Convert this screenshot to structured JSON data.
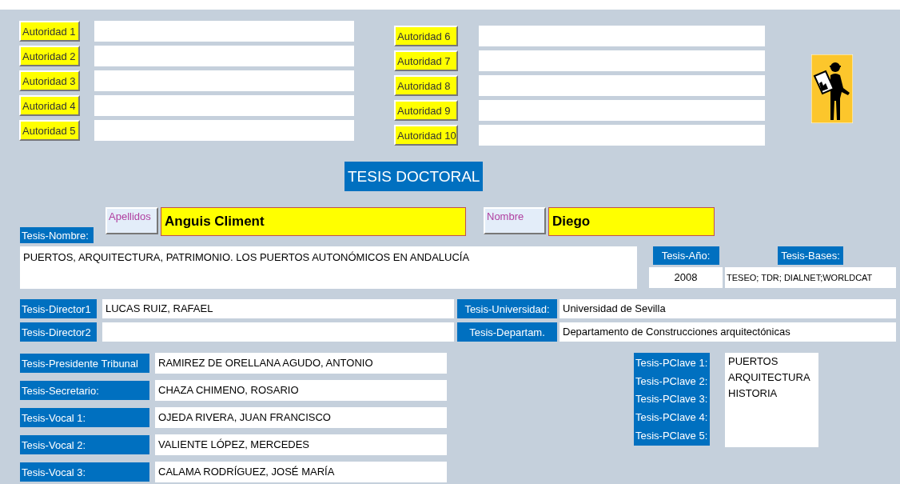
{
  "authority_buttons": [
    "Autoridad 1",
    "Autoridad 2",
    "Autoridad 3",
    "Autoridad 4",
    "Autoridad 5",
    "Autoridad 6",
    "Autoridad 7",
    "Autoridad 8",
    "Autoridad 9",
    "Autoridad 10"
  ],
  "title": "TESIS DOCTORAL",
  "name_label": "Tesis-Nombre:",
  "surname": {
    "button": "Apellidos",
    "value": "Anguis Climent"
  },
  "first_name": {
    "button": "Nombre",
    "value": "Diego"
  },
  "thesis_title": "PUERTOS, ARQUITECTURA, PATRIMONIO. LOS PUERTOS AUTONÓMICOS EN ANDALUCÍA",
  "year": {
    "label": "Tesis-Año:",
    "value": "2008"
  },
  "bases": {
    "label": "Tesis-Bases:",
    "value": "TESEO; TDR; DIALNET;WORLDCAT"
  },
  "directors": [
    {
      "label": "Tesis-Director1",
      "value": "LUCAS RUIZ, RAFAEL"
    },
    {
      "label": "Tesis-Director2"
    }
  ],
  "institutions": [
    {
      "label": "Tesis-Universidad:",
      "value": "Universidad de Sevilla"
    },
    {
      "label": "Tesis-Departam.",
      "value": "Departamento de Construcciones arquitectónicas"
    }
  ],
  "tribunal": [
    {
      "label": "Tesis-Presidente Tribunal",
      "value": "RAMIREZ DE ORELLANA AGUDO, ANTONIO"
    },
    {
      "label": "Tesis-Secretario:",
      "value": "CHAZA CHIMENO, ROSARIO"
    },
    {
      "label": "Tesis-Vocal 1:",
      "value": "OJEDA RIVERA, JUAN FRANCISCO"
    },
    {
      "label": "Tesis-Vocal 2:",
      "value": "VALIENTE LÓPEZ, MERCEDES"
    },
    {
      "label": "Tesis-Vocal 3:",
      "value": "CALAMA RODRÍGUEZ, JOSÉ MARÍA"
    }
  ],
  "keywords": {
    "labels": [
      "Tesis-PClave 1:",
      "Tesis-PClave 2:",
      "Tesis-PClave 3:",
      "Tesis-PClave 4:",
      "Tesis-PClave 5:"
    ],
    "values": [
      "PUERTOS",
      "ARQUITECTURA",
      "HISTORIA"
    ]
  }
}
